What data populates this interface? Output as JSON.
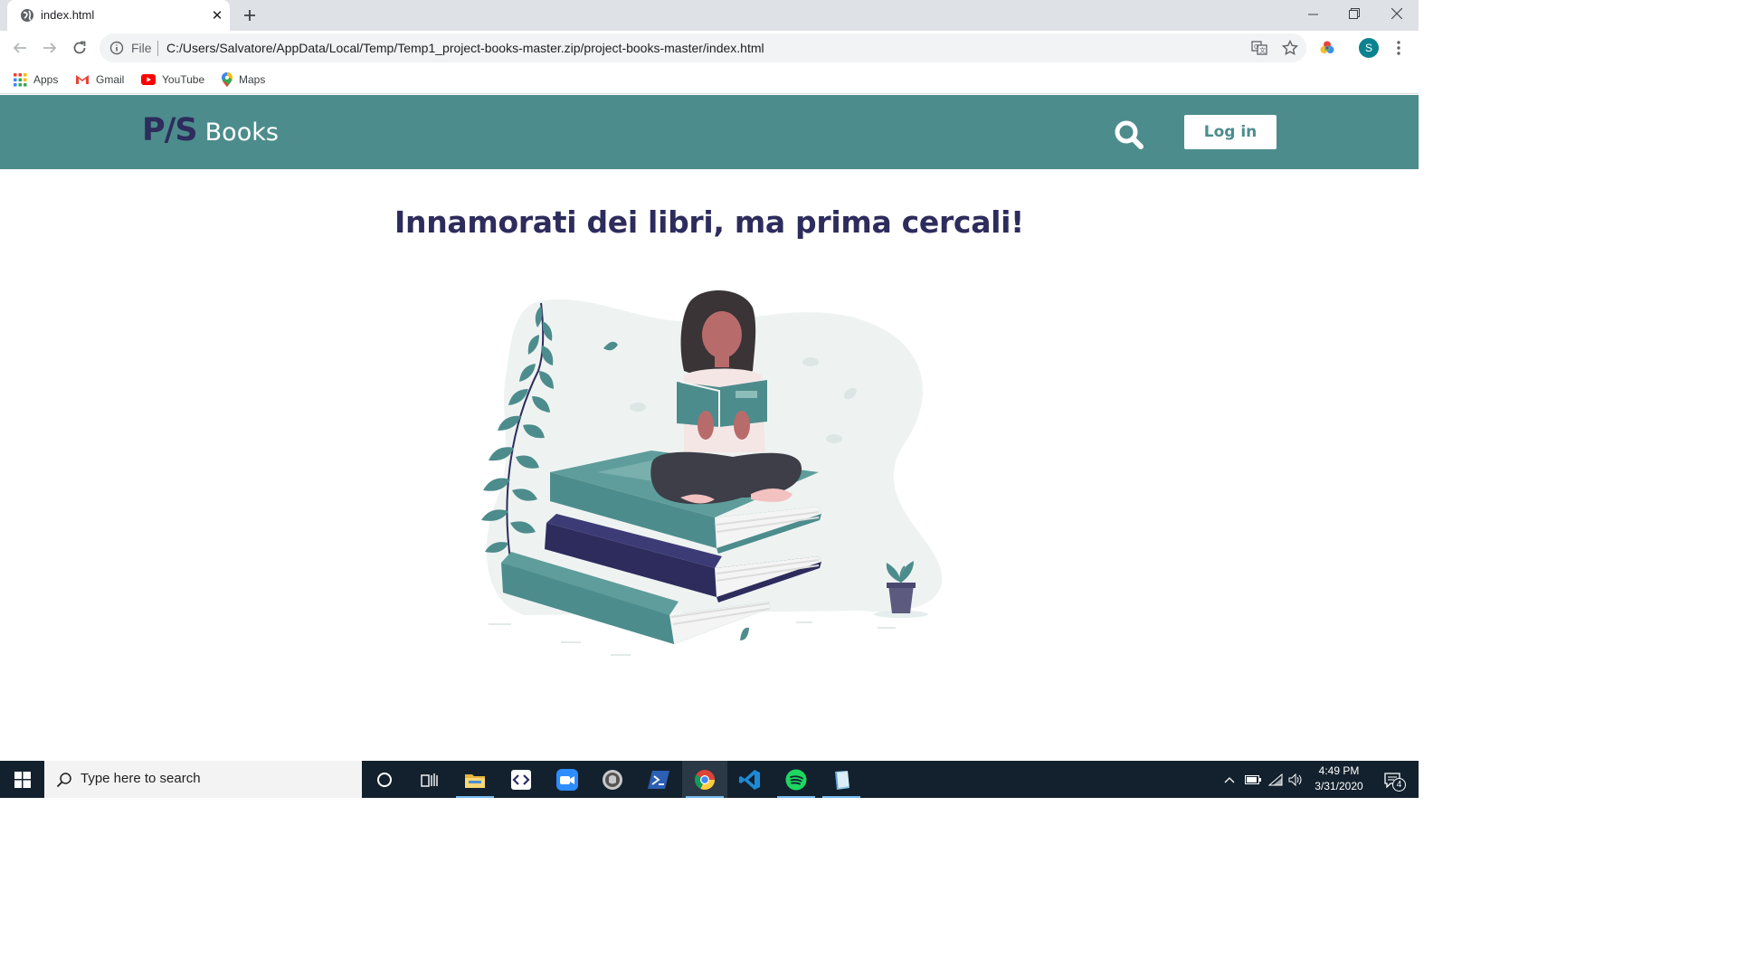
{
  "browser": {
    "tab_title": "index.html",
    "omnibox_scheme_label": "File",
    "url": "C:/Users/Salvatore/AppData/Local/Temp/Temp1_project-books-master.zip/project-books-master/index.html",
    "profile_initial": "S",
    "bookmarks": [
      {
        "label": "Apps",
        "icon": "apps-grid-icon"
      },
      {
        "label": "Gmail",
        "icon": "gmail-icon"
      },
      {
        "label": "YouTube",
        "icon": "youtube-icon"
      },
      {
        "label": "Maps",
        "icon": "maps-pin-icon"
      }
    ]
  },
  "site": {
    "logo_mark": "P/S",
    "logo_text": "Books",
    "login_label": "Log in",
    "headline": "Innamorati dei libri, ma prima cercali!",
    "colors": {
      "primary": "#4d8c8c",
      "navy": "#2d2c5c"
    }
  },
  "taskbar": {
    "search_placeholder": "Type here to search",
    "time": "4:49 PM",
    "date": "3/31/2020",
    "notification_count": "4",
    "apps": [
      "cortana-icon",
      "task-view-icon",
      "file-explorer-icon",
      "code-editor-icon",
      "zoom-icon",
      "github-desktop-icon",
      "powershell-icon",
      "chrome-icon",
      "vscode-icon",
      "spotify-icon",
      "notes-app-icon"
    ]
  }
}
